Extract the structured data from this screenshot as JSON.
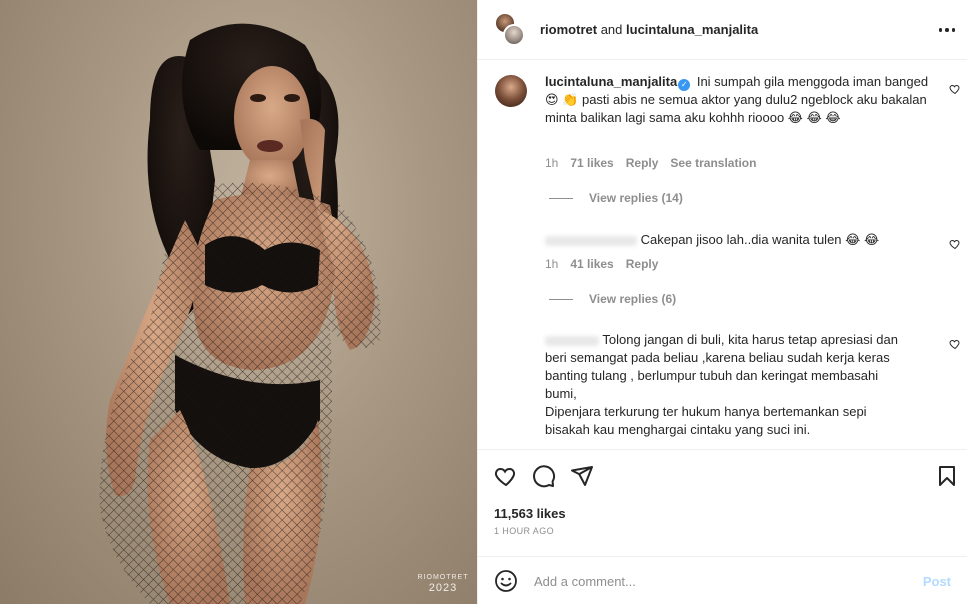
{
  "photo": {
    "watermark_name": "RIOMOTRET",
    "watermark_year": "2023"
  },
  "header": {
    "user1": "riomotret",
    "conjunction": "and",
    "user2": "lucintaluna_manjalita"
  },
  "comments": [
    {
      "username": "lucintaluna_manjalita",
      "verified": true,
      "text": "Ini sumpah gila menggoda iman banged 😍 👏 pasti abis ne semua aktor yang dulu2 ngeblock aku bakalan minta balikan lagi sama aku kohhh rioooo 😂 😂 😂",
      "time": "1h",
      "likes": "71 likes",
      "reply": "Reply",
      "translate": "See translation",
      "view_replies": "View replies (14)"
    },
    {
      "username": "",
      "text": "Cakepan jisoo lah..dia wanita tulen 😂 😂",
      "time": "1h",
      "likes": "41 likes",
      "reply": "Reply",
      "view_replies": "View replies (6)"
    },
    {
      "username": "",
      "text_lines": [
        "Tolong jangan di buli, kita harus tetap apresiasi dan",
        "beri semangat pada beliau ,karena beliau sudah kerja keras",
        "banting tulang , berlumpur tubuh dan keringat membasahi",
        "bumi,",
        "Dipenjara terkurung ter hukum hanya bertemankan sepi",
        "bisakah kau menghargai cintaku yang suci ini."
      ]
    }
  ],
  "post": {
    "likes": "11,563 likes",
    "time_ago": "1 HOUR AGO"
  },
  "composer": {
    "placeholder": "Add a comment...",
    "post_label": "Post"
  },
  "icons": {
    "like": "heart-icon",
    "comment": "comment-icon",
    "share": "send-icon",
    "save": "bookmark-icon",
    "emoji": "emoji-icon",
    "more": "more-icon",
    "verified": "verified-badge-icon"
  },
  "colors": {
    "verified": "#3897f0",
    "muted": "#8e8e8e",
    "post_button": "#b3dbff"
  }
}
